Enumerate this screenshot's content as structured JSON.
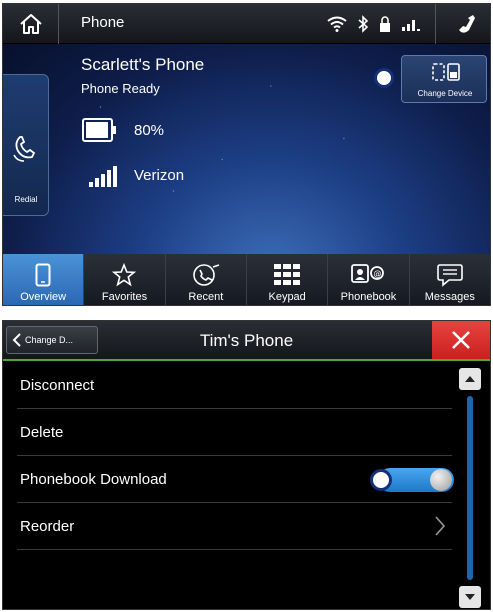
{
  "overview_screen": {
    "header": {
      "title": "Phone"
    },
    "status_icons": [
      "wifi-icon",
      "bluetooth-icon",
      "lock-icon",
      "signal-icon",
      "phone-icon"
    ],
    "phone": {
      "name": "Scarlett's Phone",
      "status": "Phone Ready",
      "battery": "80%",
      "carrier": "Verizon"
    },
    "redial_label": "Redial",
    "change_device_label": "Change Device",
    "tabs": [
      {
        "label": "Overview",
        "icon": "phone-outline-icon",
        "active": true
      },
      {
        "label": "Favorites",
        "icon": "star-icon",
        "active": false
      },
      {
        "label": "Recent",
        "icon": "recent-call-icon",
        "active": false
      },
      {
        "label": "Keypad",
        "icon": "keypad-icon",
        "active": false
      },
      {
        "label": "Phonebook",
        "icon": "phonebook-icon",
        "active": false
      },
      {
        "label": "Messages",
        "icon": "message-icon",
        "active": false
      }
    ]
  },
  "device_screen": {
    "back_label": "Change D...",
    "title": "Tim's Phone",
    "items": [
      {
        "label": "Disconnect"
      },
      {
        "label": "Delete"
      },
      {
        "label": "Phonebook Download",
        "toggle_on": true
      },
      {
        "label": "Reorder"
      }
    ]
  },
  "colors": {
    "active_tab": "#3a80c8",
    "close_button": "#d9302e",
    "toggle_on": "#2f8bd8",
    "title_underline": "#4ea83c"
  }
}
